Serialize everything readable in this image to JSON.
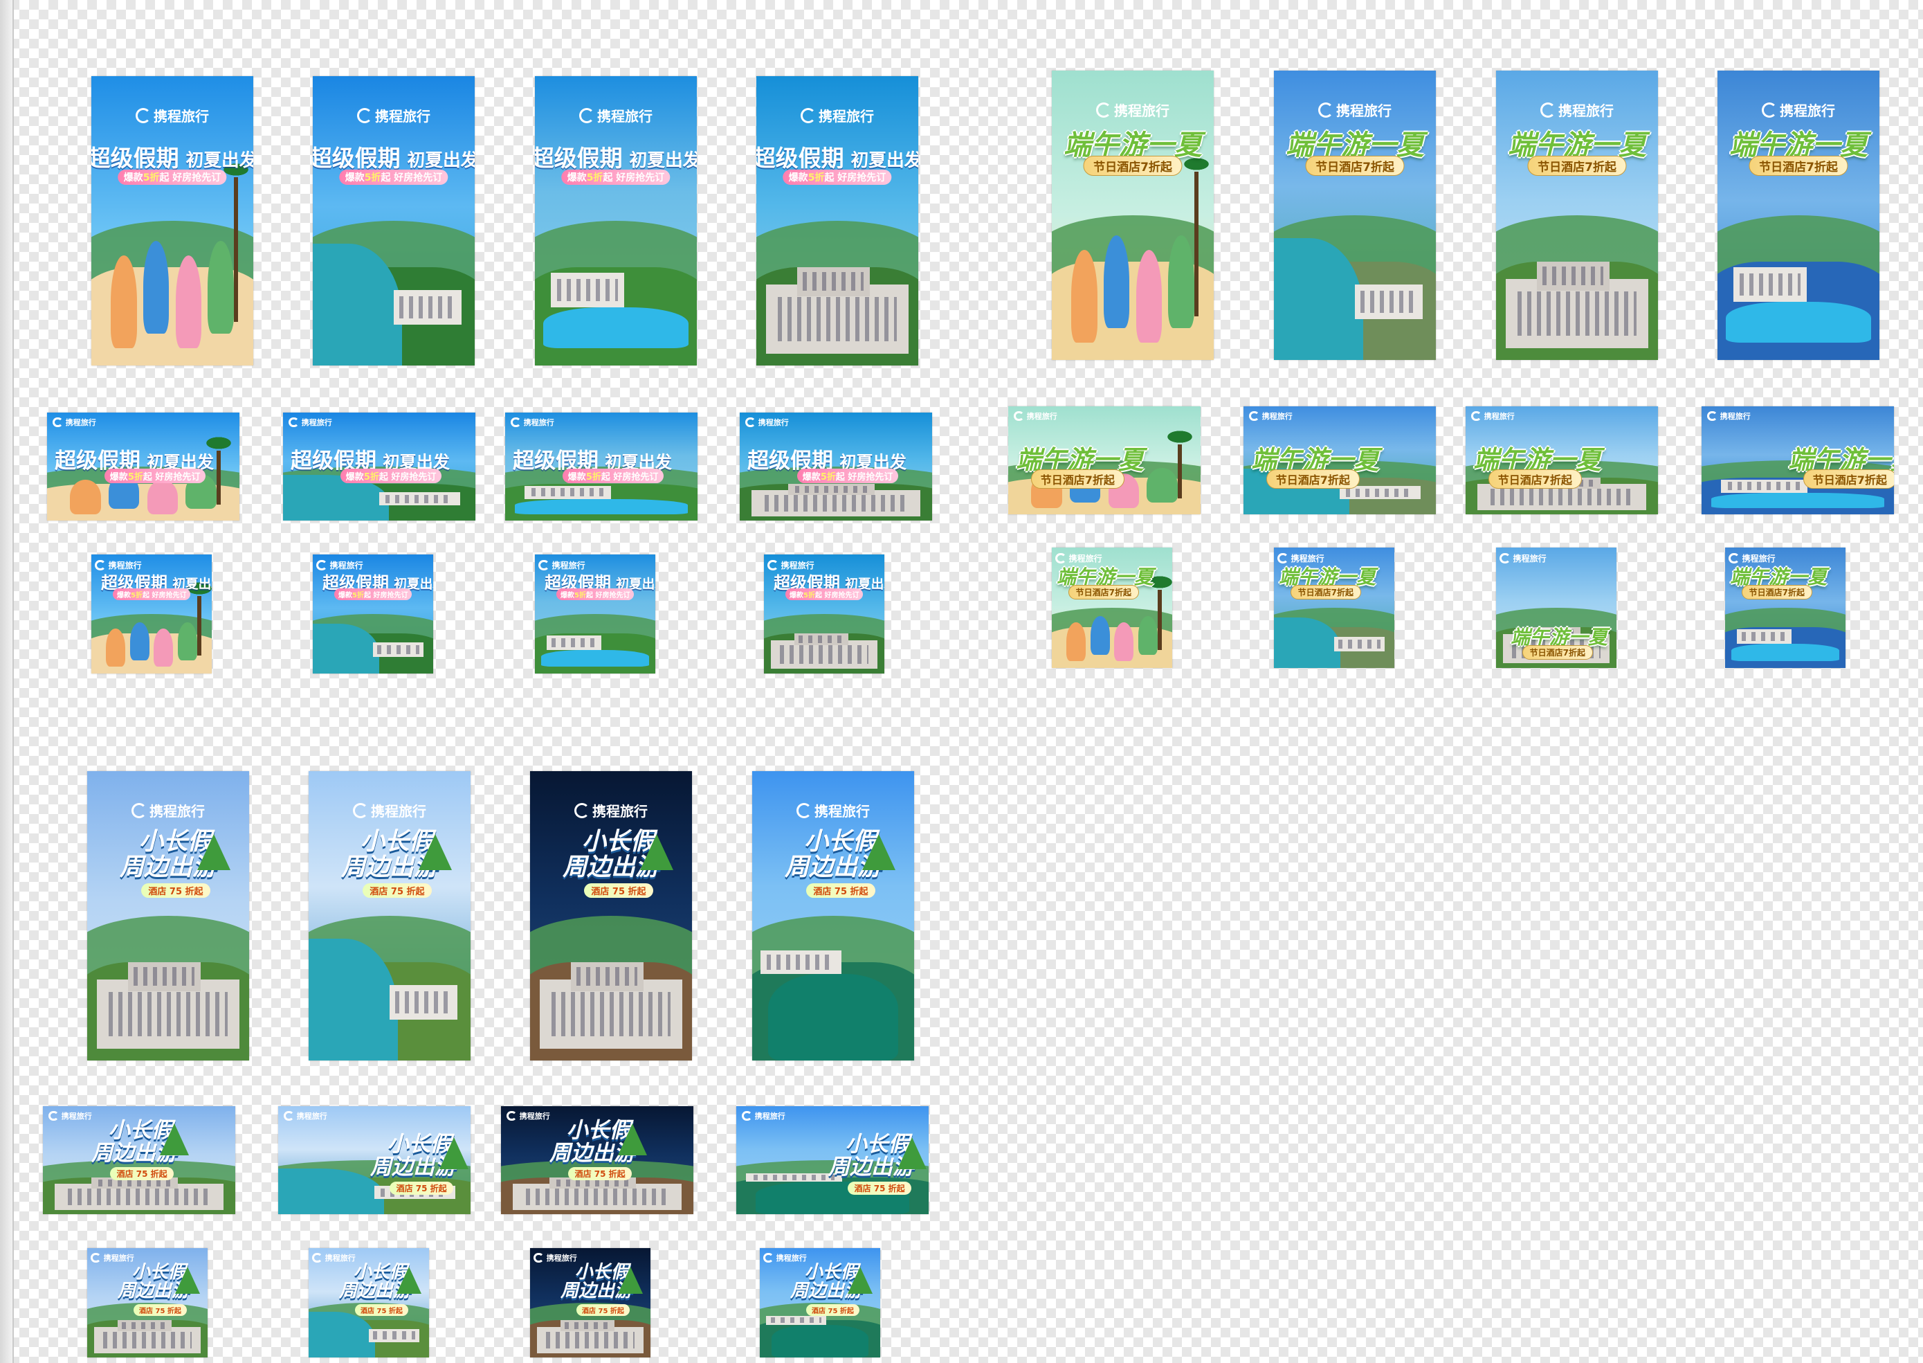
{
  "canvas": {
    "background": "transparency-checkerboard"
  },
  "colors": {
    "brand_blue": "#1e8be0",
    "festival_green": "#6fbf3a",
    "navy": "#0a1f3f",
    "pink_pill": "#ff7fb0",
    "gold_pill": "#f6d37a"
  },
  "groups": {
    "summer": {
      "logo": "携程旅行",
      "title": "超级假期",
      "subtitle": "初夏出发",
      "pill_left": "爆款",
      "pill_hot": "5折",
      "pill_right": "起 好房抢先订"
    },
    "dragon_boat": {
      "logo": "携程旅行",
      "title": "端午游一夏",
      "pill": "节日酒店7折起"
    },
    "short_break": {
      "logo": "携程旅行",
      "title_line1": "小长假",
      "title_line2": "周边出游",
      "pill": "酒店 75 折起"
    }
  }
}
